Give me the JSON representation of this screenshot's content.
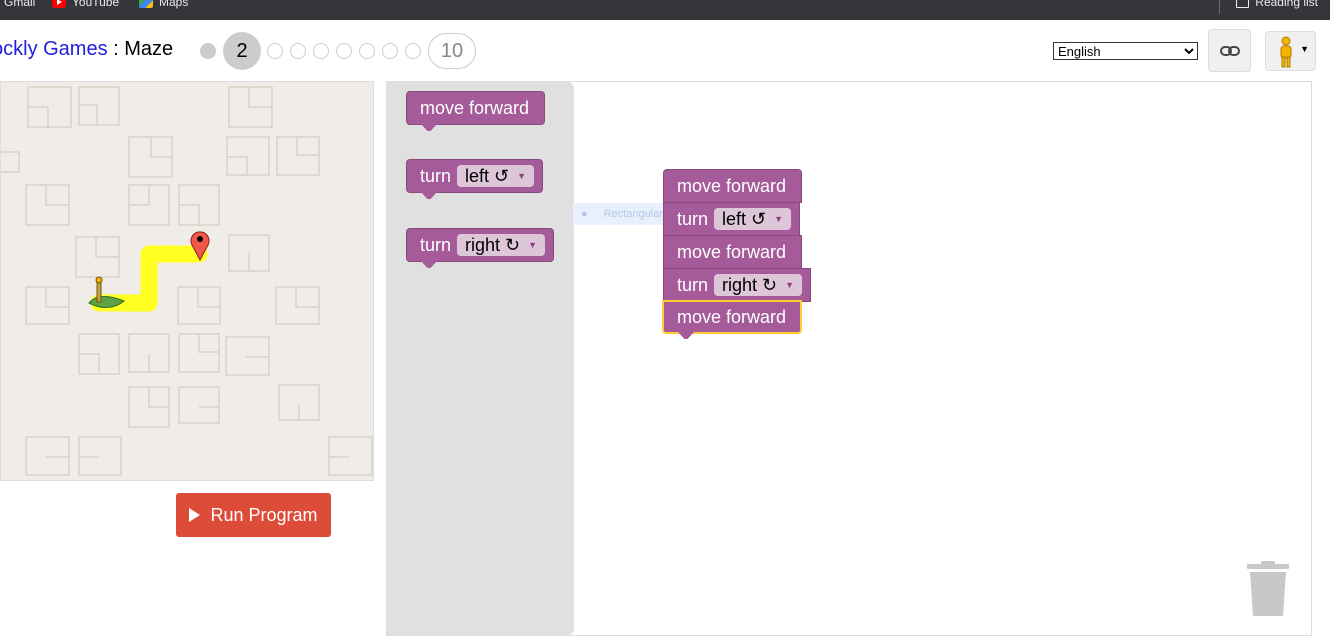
{
  "bookmarks": {
    "gmail": "Gmail",
    "youtube": "YouTube",
    "maps": "Maps",
    "reading_list": "Reading list"
  },
  "header": {
    "title_link": "ockly Games",
    "title_sep": " : ",
    "title_page": "Maze",
    "current_level": "2",
    "last_level": "10",
    "language": "English"
  },
  "run_button": "Run Program",
  "toolbox": {
    "move_forward": "move forward",
    "turn": "turn",
    "left": "left ↺",
    "right": "right ↻"
  },
  "workspace": {
    "blocks": [
      {
        "type": "move",
        "label": "move forward"
      },
      {
        "type": "turn",
        "label": "turn",
        "dir": "left ↺"
      },
      {
        "type": "move",
        "label": "move forward"
      },
      {
        "type": "turn",
        "label": "turn",
        "dir": "right ↻"
      },
      {
        "type": "move",
        "label": "move forward",
        "selected": true
      }
    ],
    "ghost_text": "Rectangular"
  },
  "colors": {
    "block": "#a55b99",
    "path": "#ffff22",
    "run_button": "#dd4b39",
    "selection": "#ffcc33"
  }
}
